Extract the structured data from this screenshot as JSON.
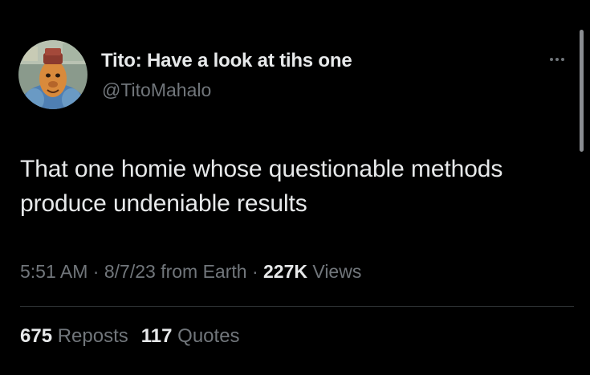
{
  "author": {
    "display_name": "Tito: Have a look at tihs one",
    "handle": "@TitoMahalo",
    "avatar_icon": "cartoon-character-avatar"
  },
  "post": {
    "text_line1": "That one homie whose questionable methods",
    "text_line2": "produce undeniable results"
  },
  "meta": {
    "time": "5:51 AM",
    "separator": "·",
    "date": "8/7/23",
    "source": "from Earth",
    "views_count": "227K",
    "views_label": "Views"
  },
  "stats": {
    "reposts_count": "675",
    "reposts_label": "Reposts",
    "quotes_count": "117",
    "quotes_label": "Quotes"
  },
  "colors": {
    "background": "#000000",
    "primary_text": "#e7e9ea",
    "secondary_text": "#71767b",
    "divider": "#2f3336"
  }
}
